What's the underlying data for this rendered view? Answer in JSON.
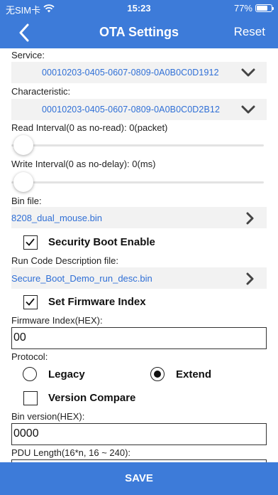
{
  "status_bar": {
    "carrier": "无SIM卡",
    "time": "15:23",
    "battery_percent": "77%",
    "battery_level": 0.77
  },
  "nav": {
    "title": "OTA Settings",
    "action": "Reset"
  },
  "service": {
    "label": "Service:",
    "value": "00010203-0405-0607-0809-0A0B0C0D1912"
  },
  "characteristic": {
    "label": "Characteristic:",
    "value": "00010203-0405-0607-0809-0A0B0C0D2B12"
  },
  "read_interval": {
    "label": "Read Interval(0 as no-read): 0(packet)",
    "value": 0
  },
  "write_interval": {
    "label": "Write Interval(0 as no-delay): 0(ms)",
    "value": 0
  },
  "bin_file": {
    "label": "Bin file:",
    "value": "8208_dual_mouse.bin"
  },
  "security_boot": {
    "label": "Security Boot Enable",
    "checked": true
  },
  "run_code": {
    "label": "Run Code Description file:",
    "value": "Secure_Boot_Demo_run_desc.bin"
  },
  "set_firmware_index": {
    "label": "Set Firmware Index",
    "checked": true
  },
  "firmware_index": {
    "label": "Firmware Index(HEX):",
    "value": "00"
  },
  "protocol": {
    "label": "Protocol:",
    "options": [
      "Legacy",
      "Extend"
    ],
    "selected": "Extend"
  },
  "version_compare": {
    "label": "Version Compare",
    "checked": false
  },
  "bin_version": {
    "label": "Bin version(HEX):",
    "value": "0000"
  },
  "pdu_length": {
    "label": "PDU Length(16*n, 16 ~ 240):"
  },
  "save": {
    "label": "SAVE"
  },
  "colors": {
    "accent": "#3d7bd9",
    "link": "#2f6fd6",
    "field_bg": "#f2f2f2"
  },
  "icons": [
    "back-chevron-icon",
    "signal-wifi-icon",
    "battery-icon",
    "chevron-down-icon",
    "chevron-right-icon",
    "checkmark-icon"
  ]
}
